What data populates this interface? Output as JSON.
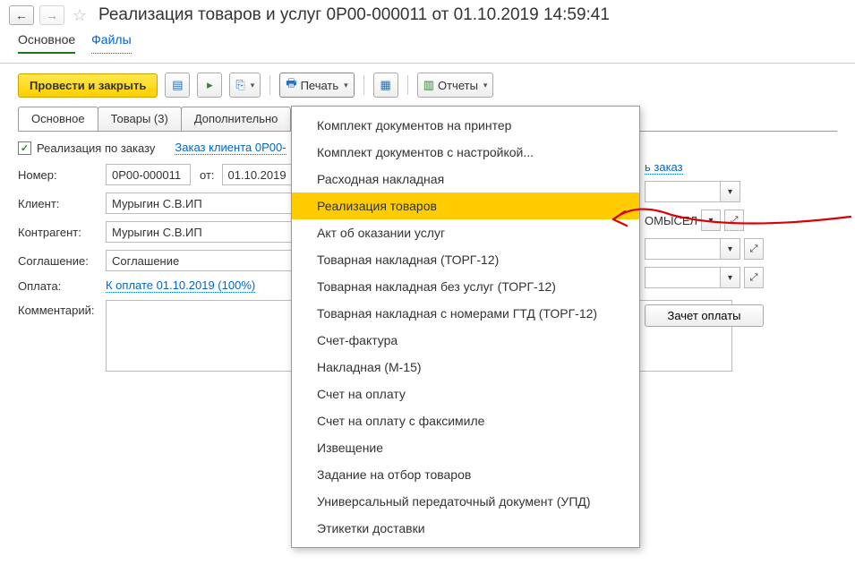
{
  "header": {
    "title": "Реализация товаров и услуг 0Р00-000011 от 01.10.2019 14:59:41"
  },
  "subnav": {
    "main": "Основное",
    "files": "Файлы"
  },
  "toolbar": {
    "post_close": "Провести и закрыть",
    "print": "Печать",
    "reports": "Отчеты"
  },
  "tabs": {
    "main": "Основное",
    "goods": "Товары (3)",
    "extra": "Дополнительно"
  },
  "form": {
    "by_order_label": "Реализация по заказу",
    "by_order_link": "Заказ клиента 0Р00-",
    "number_lbl": "Номер:",
    "number_val": "0Р00-000011",
    "from_lbl": "от:",
    "date_val": "01.10.2019",
    "client_lbl": "Клиент:",
    "client_val": "Мурыгин С.В.ИП",
    "counterparty_lbl": "Контрагент:",
    "counterparty_val": "Мурыгин С.В.ИП",
    "agreement_lbl": "Соглашение:",
    "agreement_val": "Соглашение",
    "payment_lbl": "Оплата:",
    "payment_link": "К оплате 01.10.2019 (100%)",
    "comment_lbl": "Комментарий:",
    "right_link_order": "ь заказ",
    "right_val": "ОМЫСЕЛ",
    "offset_btn": "Зачет оплаты"
  },
  "print_menu": {
    "items": [
      "Комплект документов на принтер",
      "Комплект документов с настройкой...",
      "Расходная накладная",
      "Реализация товаров",
      "Акт об оказании услуг",
      "Товарная накладная (ТОРГ-12)",
      "Товарная накладная без услуг (ТОРГ-12)",
      "Товарная накладная с номерами ГТД (ТОРГ-12)",
      "Счет-фактура",
      "Накладная (М-15)",
      "Счет на оплату",
      "Счет на оплату с факсимиле",
      "Извещение",
      "Задание на отбор товаров",
      "Универсальный передаточный документ (УПД)",
      "Этикетки доставки"
    ],
    "highlighted_index": 3
  }
}
